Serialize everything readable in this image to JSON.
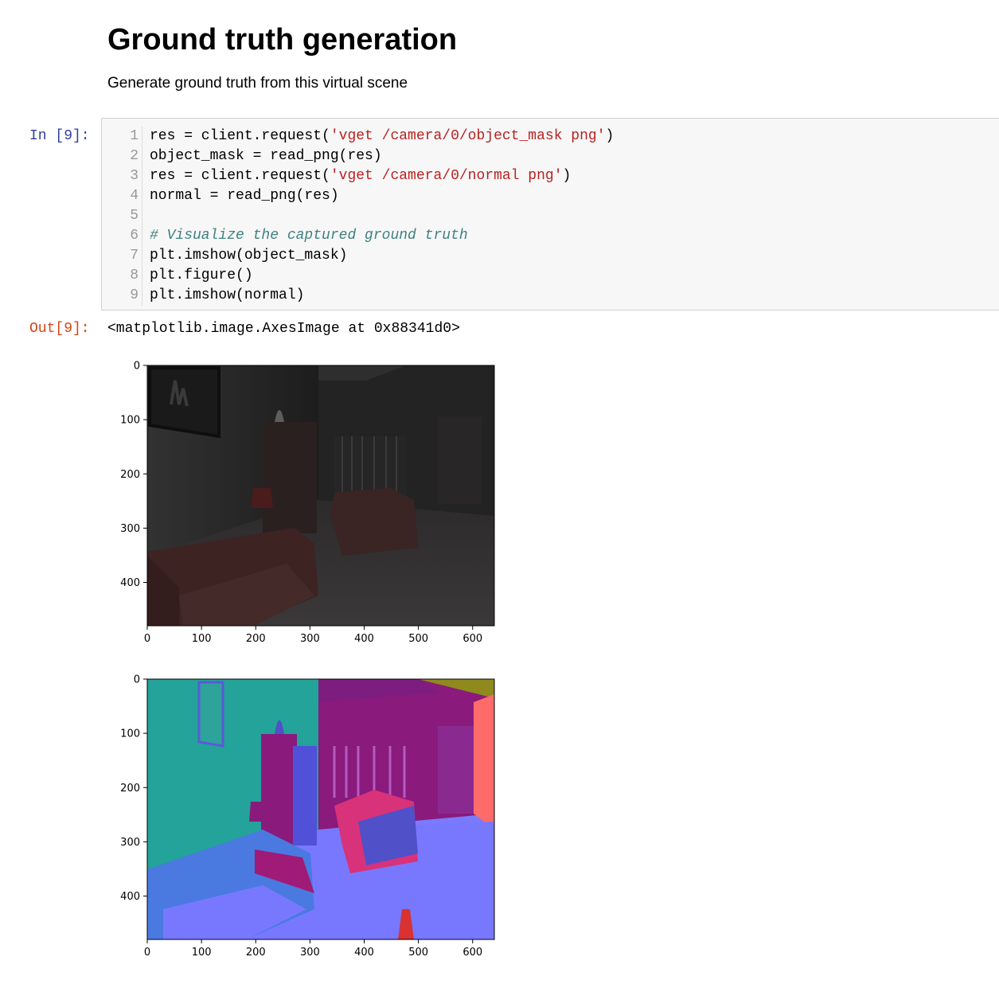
{
  "markdown": {
    "heading": "Ground truth generation",
    "paragraph": "Generate ground truth from this virtual scene"
  },
  "cell": {
    "in_prompt": "In [9]:",
    "out_prompt": "Out[9]:",
    "lines": [
      {
        "n": "1",
        "parts": [
          {
            "t": "res = client.request(",
            "k": "code"
          },
          {
            "t": "'vget /camera/0/object_mask png'",
            "k": "str"
          },
          {
            "t": ")",
            "k": "code"
          }
        ]
      },
      {
        "n": "2",
        "parts": [
          {
            "t": "object_mask = read_png(res)",
            "k": "code"
          }
        ]
      },
      {
        "n": "3",
        "parts": [
          {
            "t": "res = client.request(",
            "k": "code"
          },
          {
            "t": "'vget /camera/0/normal png'",
            "k": "str"
          },
          {
            "t": ")",
            "k": "code"
          }
        ]
      },
      {
        "n": "4",
        "parts": [
          {
            "t": "normal = read_png(res)",
            "k": "code"
          }
        ]
      },
      {
        "n": "5",
        "parts": [
          {
            "t": "",
            "k": "code"
          }
        ]
      },
      {
        "n": "6",
        "parts": [
          {
            "t": "# Visualize the captured ground truth",
            "k": "cmt"
          }
        ]
      },
      {
        "n": "7",
        "parts": [
          {
            "t": "plt.imshow(object_mask)",
            "k": "code"
          }
        ]
      },
      {
        "n": "8",
        "parts": [
          {
            "t": "plt.figure()",
            "k": "code"
          }
        ]
      },
      {
        "n": "9",
        "parts": [
          {
            "t": "plt.imshow(normal)",
            "k": "code"
          }
        ]
      }
    ],
    "output_text": "<matplotlib.image.AxesImage at 0x88341d0>"
  },
  "plots": [
    {
      "x_ticks": [
        "0",
        "100",
        "200",
        "300",
        "400",
        "500",
        "600"
      ],
      "y_ticks": [
        "0",
        "100",
        "200",
        "300",
        "400"
      ]
    },
    {
      "x_ticks": [
        "0",
        "100",
        "200",
        "300",
        "400",
        "500",
        "600"
      ],
      "y_ticks": [
        "0",
        "100",
        "200",
        "300",
        "400"
      ]
    }
  ],
  "colors": {
    "prompt_in": "#303f9f",
    "prompt_out": "#d84315",
    "string": "#ba2121",
    "comment": "#408080"
  }
}
